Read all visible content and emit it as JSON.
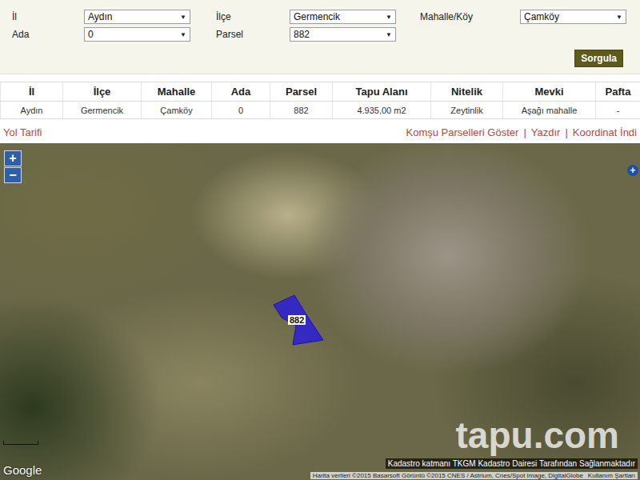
{
  "form": {
    "fields": [
      {
        "label": "İl",
        "value": "Aydın"
      },
      {
        "label": "İlçe",
        "value": "Germencik"
      },
      {
        "label": "Mahalle/Köy",
        "value": "Çamköy"
      },
      {
        "label": "Ada",
        "value": "0"
      },
      {
        "label": "Parsel",
        "value": "882"
      }
    ],
    "arrow": "▼",
    "button": "Sorgula"
  },
  "table": {
    "columns": [
      "İl",
      "İlçe",
      "Mahalle",
      "Ada",
      "Parsel",
      "Tapu Alanı",
      "Nitelik",
      "Mevki",
      "Pafta"
    ],
    "rows": [
      [
        "Aydın",
        "Germencik",
        "Çamköy",
        "0",
        "882",
        "4.935,00 m2",
        "Zeytinlik",
        "Aşağı mahalle",
        "-"
      ]
    ]
  },
  "links": {
    "left": "Yol Tarifi",
    "right": [
      "Komşu Parselleri Göster",
      "Yazdır",
      "Koordinat İndi"
    ],
    "separator": "|"
  },
  "map": {
    "zoom_in": "+",
    "zoom_out": "−",
    "side_button": "+",
    "parcel_label": "882",
    "logo": "Google",
    "watermark": "tapu.com",
    "kadastro_note": "Kadastro katmanı TKGM Kadastro Dairesi Tarafından Sağlanmaktadır",
    "attribution": "Harita verileri ©2015 Basarsoft Görüntü ©2015 CNES / Astrium, Cnes/Spot Image, DigitalGlobe",
    "terms": "Kullanım Şartları"
  }
}
